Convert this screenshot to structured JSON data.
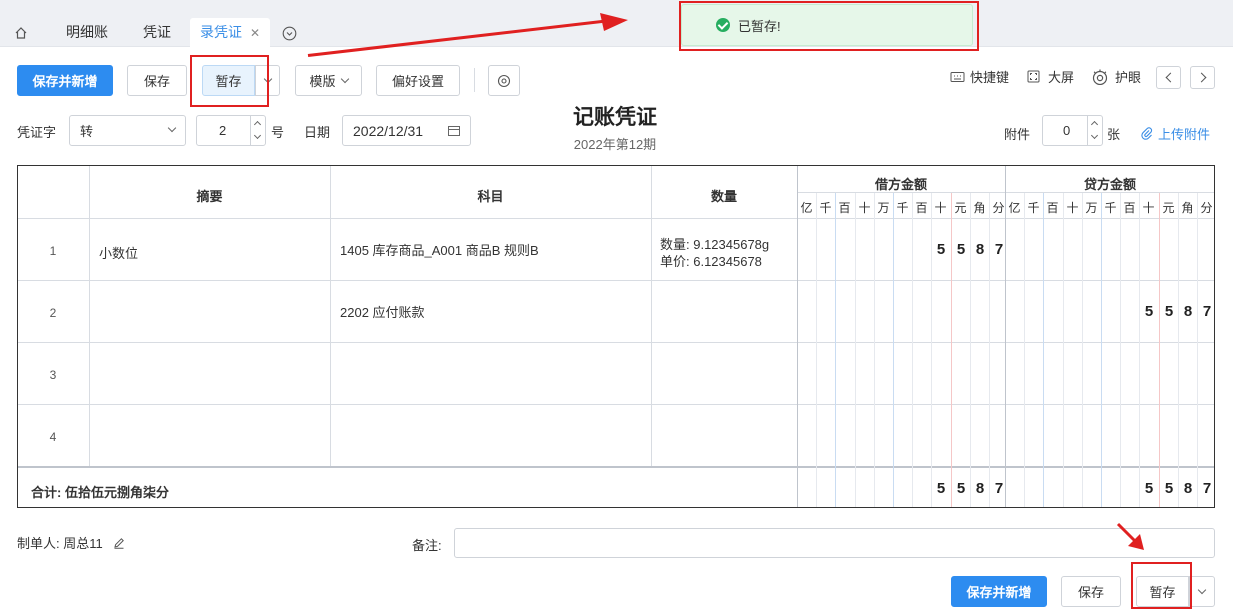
{
  "tabs": [
    {
      "label": "明细账"
    },
    {
      "label": "凭证"
    },
    {
      "label": "录凭证"
    }
  ],
  "toast": {
    "message": "已暂存!"
  },
  "toolbar": {
    "save_new": "保存并新增",
    "save": "保存",
    "temp_save": "暂存",
    "template": "模版",
    "preferences": "偏好设置",
    "shortcuts": "快捷键",
    "fullscreen": "大屏",
    "eye_care": "护眼"
  },
  "voucher": {
    "title": "记账凭证",
    "period": "2022年第12期",
    "word_label": "凭证字",
    "word_value": "转",
    "number_value": "2",
    "number_suffix": "号",
    "date_label": "日期",
    "date_value": "2022/12/31",
    "attach_label": "附件",
    "attach_value": "0",
    "attach_unit": "张",
    "upload": "上传附件"
  },
  "table": {
    "headers": {
      "summary": "摘要",
      "account": "科目",
      "quantity": "数量",
      "debit": "借方金额",
      "credit": "贷方金额"
    },
    "digits": [
      "亿",
      "千",
      "百",
      "十",
      "万",
      "千",
      "百",
      "十",
      "元",
      "角",
      "分"
    ],
    "rows": [
      {
        "no": "1",
        "summary": "小数位",
        "account": "1405 库存商品_A001 商品B 规则B",
        "qty_line1": "数量: 9.12345678g",
        "qty_line2": "单价: 6.12345678",
        "debit": [
          "5",
          "5",
          "8",
          "7"
        ],
        "credit": []
      },
      {
        "no": "2",
        "summary": "",
        "account": "2202 应付账款",
        "qty_line1": "",
        "qty_line2": "",
        "debit": [],
        "credit": [
          "5",
          "5",
          "8",
          "7"
        ]
      },
      {
        "no": "3",
        "summary": "",
        "account": "",
        "qty_line1": "",
        "qty_line2": "",
        "debit": [],
        "credit": []
      },
      {
        "no": "4",
        "summary": "",
        "account": "",
        "qty_line1": "",
        "qty_line2": "",
        "debit": [],
        "credit": []
      }
    ],
    "total_label": "合计: 伍拾伍元捌角柒分",
    "total_debit": [
      "5",
      "5",
      "8",
      "7"
    ],
    "total_credit": [
      "5",
      "5",
      "8",
      "7"
    ]
  },
  "footer": {
    "maker_label": "制单人: 周总11",
    "remark_label": "备注:",
    "save_new": "保存并新增",
    "save": "保存",
    "temp_save": "暂存"
  }
}
